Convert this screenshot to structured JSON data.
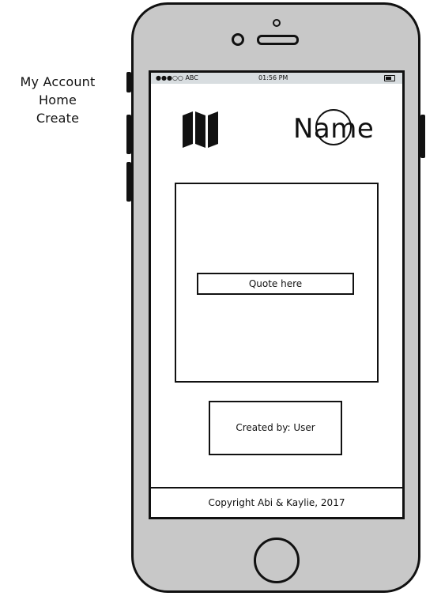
{
  "side_menu": {
    "items": [
      {
        "label": "My Account"
      },
      {
        "label": "Home"
      },
      {
        "label": "Create"
      }
    ]
  },
  "status_bar": {
    "carrier": "●●●○○ ABC",
    "time": "01:56 PM",
    "battery_icon": "battery-icon"
  },
  "header": {
    "map_icon": "map-icon",
    "logo_text": "Name"
  },
  "quote": {
    "label": "Quote here"
  },
  "created_by": {
    "label": "Created by: User"
  },
  "footer": {
    "copyright": "Copyright Abi & Kaylie, 2017"
  }
}
